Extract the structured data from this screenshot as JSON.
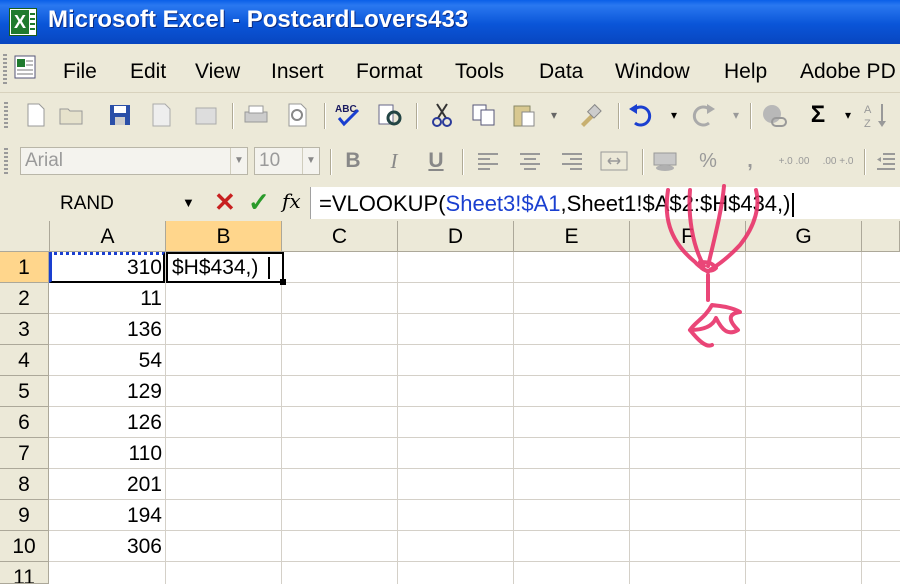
{
  "window": {
    "title": "Microsoft Excel - PostcardLovers433"
  },
  "menu": {
    "items": [
      "File",
      "Edit",
      "View",
      "Insert",
      "Format",
      "Tools",
      "Data",
      "Window",
      "Help",
      "Adobe PD"
    ]
  },
  "format_toolbar": {
    "font": "Arial",
    "size": "10",
    "bold": "B",
    "italic": "I",
    "underline": "U",
    "percent": "%",
    "comma": ",",
    "inc_decimal": "+.0 .00",
    "dec_decimal": ".00 +.0"
  },
  "standard_toolbar": {
    "sum": "Σ"
  },
  "formula_bar": {
    "name_box": "RAND",
    "fx": "fx",
    "formula_prefix": "=VLOOKUP(",
    "formula_ref": "Sheet3!$A1",
    "formula_rest": ",Sheet1!$A$2:$H$434,)"
  },
  "sheet": {
    "columns": [
      "A",
      "B",
      "C",
      "D",
      "E",
      "F",
      "G"
    ],
    "rows": [
      "1",
      "2",
      "3",
      "4",
      "5",
      "6",
      "7",
      "8",
      "9",
      "10",
      "11"
    ],
    "column_a_values": [
      "310",
      "11",
      "136",
      "54",
      "129",
      "126",
      "110",
      "201",
      "194",
      "306"
    ],
    "b1_text": "$H$434,)",
    "selected_column": "B",
    "selected_row": "1"
  },
  "colors": {
    "title_bar": "#0a55d8",
    "reference_blue": "#1a3fd0",
    "annotation": "#e8336a",
    "selection_header": "#ffd68c"
  }
}
